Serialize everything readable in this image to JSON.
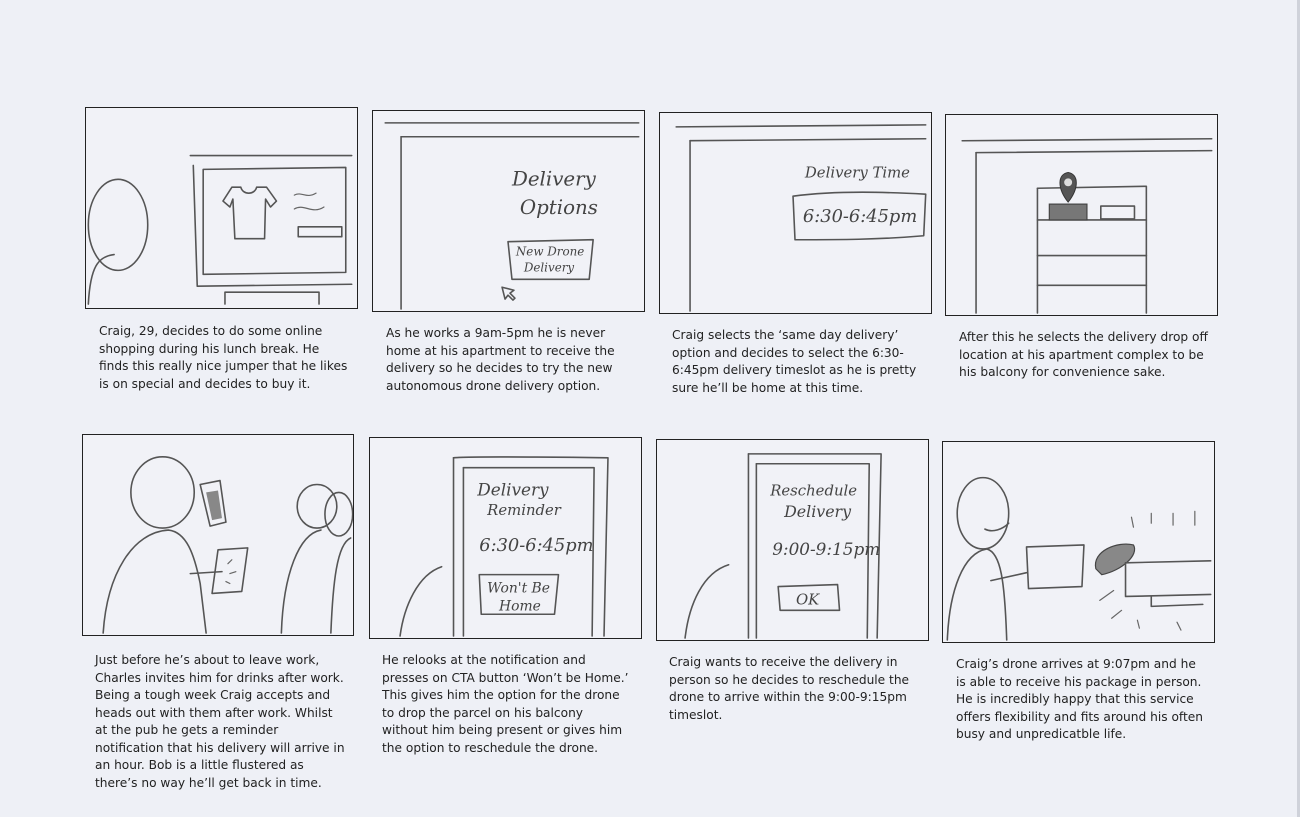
{
  "storyboard": {
    "panels": [
      {
        "caption": "Craig, 29, decides to do some online shopping during his lunch break. He finds this really nice jumper that he likes is on special and decides to buy it.",
        "sketch_text": []
      },
      {
        "caption": "As he works a 9am-5pm he is never home at his apartment to receive the delivery so he decides to try the new autonomous drone delivery option.",
        "sketch_text": [
          "Delivery",
          "Options",
          "New Drone",
          "Delivery"
        ]
      },
      {
        "caption": "Craig selects the ‘same day delivery’ option and decides to select the 6:30-6:45pm delivery timeslot as he is pretty sure he’ll be home at this time.",
        "sketch_text": [
          "Delivery Time",
          "6:30-6:45pm"
        ]
      },
      {
        "caption": "After this he selects the delivery drop off location at his apartment complex to be his balcony for convenience sake.",
        "sketch_text": []
      },
      {
        "caption": "Just before he’s about to leave work, Charles invites him for drinks after work. Being a tough week Craig accepts and heads out with them after work. Whilst at the pub he gets a reminder notification that his delivery will arrive in an hour. Bob is a little flustered as there’s no way he’ll get back in time.",
        "sketch_text": []
      },
      {
        "caption": "He relooks at the notification and presses on CTA button ‘Won’t be Home.’ This gives him the option for the drone to drop the parcel on his balcony without him being present or gives him the option to reschedule the drone.",
        "sketch_text": [
          "Delivery",
          "Reminder",
          "6:30-6:45pm",
          "Won't Be",
          "Home"
        ]
      },
      {
        "caption": "Craig wants to receive the delivery in person so he decides to reschedule the drone to arrive within the 9:00-9:15pm timeslot.",
        "sketch_text": [
          "Reschedule",
          "Delivery",
          "9:00-9:15pm",
          "OK"
        ]
      },
      {
        "caption": "Craig’s drone arrives at 9:07pm and he is able to receive his package in person. He is incredibly happy that this service offers flexibility and fits around his often busy and unpredicatble life.",
        "sketch_text": []
      }
    ]
  }
}
